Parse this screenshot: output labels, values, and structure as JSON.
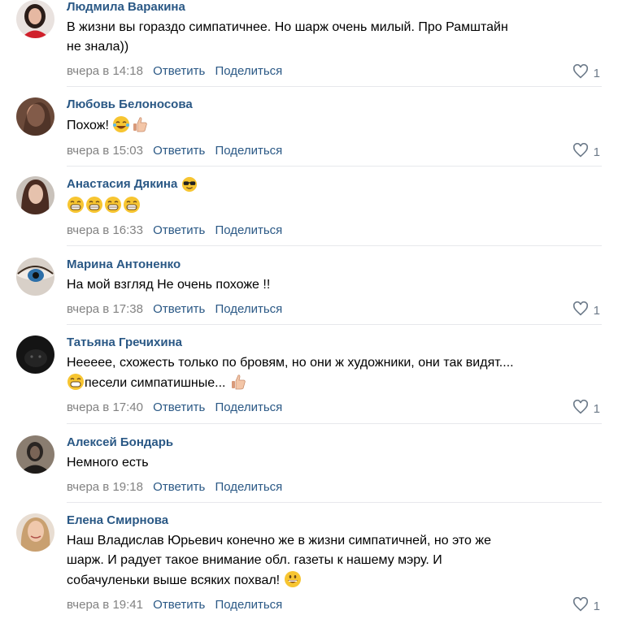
{
  "actions": {
    "reply": "Ответить",
    "share": "Поделиться"
  },
  "comments": [
    {
      "author": "Людмила Варакина",
      "text": "В жизни вы гораздо симпатичнее. Но шарж очень милый. Про Рамштайн\nне знала))",
      "date": "вчера в 14:18",
      "likes": "1"
    },
    {
      "author": "Любовь Белоносова",
      "text": "Похож! ",
      "date": "вчера в 15:03",
      "likes": "1"
    },
    {
      "author": "Анастасия Дякина",
      "text": "",
      "date": "вчера в 16:33",
      "likes": ""
    },
    {
      "author": "Марина Антоненко",
      "text": "На мой взгляд Не очень похоже !!",
      "date": "вчера в 17:38",
      "likes": "1"
    },
    {
      "author": "Татьяна Гречихина",
      "text": "Неееее, схожесть только по бровям, но они ж художники, они так видят....",
      "text2": "песели симпатишные... ",
      "date": "вчера в 17:40",
      "likes": "1"
    },
    {
      "author": "Алексей Бондарь",
      "text": "Немного есть",
      "date": "вчера в 19:18",
      "likes": ""
    },
    {
      "author": "Елена Смирнова",
      "text": "Наш Владислав Юрьевич конечно же в жизни симпатичней, но это же\nшарж. И радует такое внимание обл. газеты к нашему мэру. И\nсобачуленьки выше всяких похвал! ",
      "date": "вчера в 19:41",
      "likes": "1"
    }
  ],
  "icons": {
    "like": "heart-outline-icon",
    "laugh": "tears-of-joy-emoji",
    "thumbs": "thumbs-up-emoji",
    "cool": "sunglasses-emoji",
    "grin": "grinning-emoji",
    "smile": "smiling-emoji"
  },
  "colors": {
    "link": "#2a5885",
    "meta": "#828282",
    "divider": "#e7e8ec"
  }
}
